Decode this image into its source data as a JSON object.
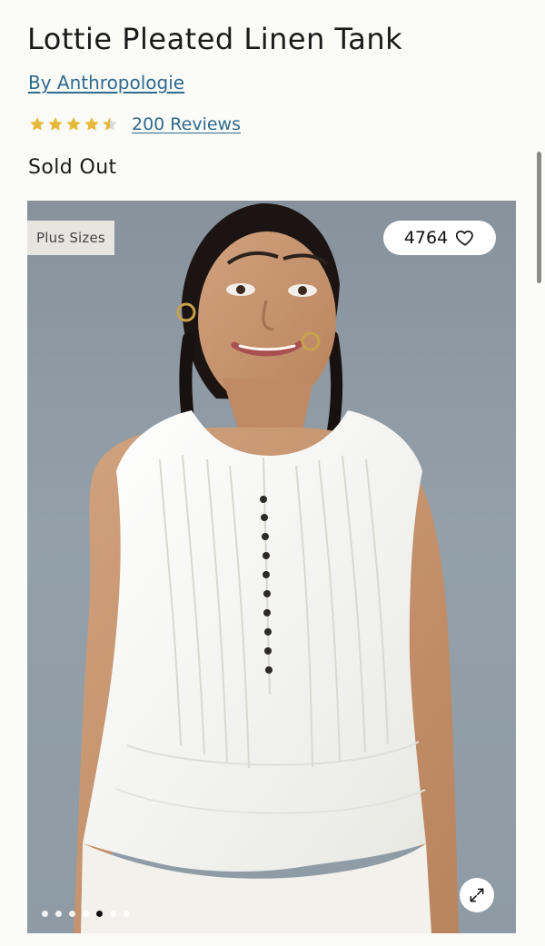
{
  "product": {
    "title": "Lottie Pleated Linen Tank",
    "brand_link": "By Anthropologie",
    "rating_stars": 4.5,
    "reviews_link": "200 Reviews",
    "stock_status": "Sold Out"
  },
  "image": {
    "badge": "Plus Sizes",
    "likes": "4764",
    "pager_total": 7,
    "pager_active_index": 4
  },
  "colors": {
    "page_bg": "#fbfbf7",
    "link": "#2f6a8f",
    "star": "#e5b93b"
  },
  "icons": {
    "heart": "heart-icon",
    "expand": "expand-icon",
    "star": "star-icon"
  }
}
